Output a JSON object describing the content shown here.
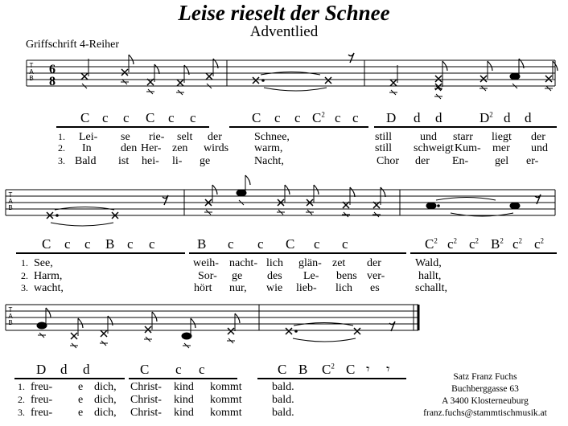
{
  "title": "Leise rieselt der Schnee",
  "subtitle": "Adventlied",
  "notation_label": "Griffschrift 4-Reiher",
  "time_signature": {
    "top": "6",
    "bottom": "8"
  },
  "tab_label": [
    "T",
    "A",
    "B"
  ],
  "system1": {
    "bass": [
      {
        "text": "C",
        "sup": ""
      },
      {
        "text": "c",
        "sup": ""
      },
      {
        "text": "c",
        "sup": ""
      },
      {
        "text": "C",
        "sup": ""
      },
      {
        "text": "c",
        "sup": ""
      },
      {
        "text": "c",
        "sup": ""
      },
      {
        "text": "C",
        "sup": ""
      },
      {
        "text": "c",
        "sup": ""
      },
      {
        "text": "c",
        "sup": ""
      },
      {
        "text": "C",
        "sup": "2"
      },
      {
        "text": "c",
        "sup": ""
      },
      {
        "text": "c",
        "sup": ""
      },
      {
        "text": "D",
        "sup": ""
      },
      {
        "text": "d",
        "sup": ""
      },
      {
        "text": "d",
        "sup": ""
      },
      {
        "text": "D",
        "sup": "2"
      },
      {
        "text": "d",
        "sup": ""
      },
      {
        "text": "d",
        "sup": ""
      }
    ],
    "verses": [
      {
        "num": "1.",
        "words": [
          "Lei-",
          "se",
          "rie-",
          "selt",
          "der",
          "Schnee,",
          "still",
          "und",
          "starr",
          "liegt",
          "der"
        ]
      },
      {
        "num": "2.",
        "words": [
          "In",
          "den",
          "Her-",
          "zen",
          "wirds",
          "warm,",
          "still",
          "schweigt",
          "Kum-",
          "mer",
          "und"
        ]
      },
      {
        "num": "3.",
        "words": [
          "Bald",
          "ist",
          "hei-",
          "li-",
          "ge",
          "Nacht,",
          "Chor",
          "der",
          "En-",
          "gel",
          "er-"
        ]
      }
    ]
  },
  "system2": {
    "bass": [
      {
        "text": "C",
        "sup": ""
      },
      {
        "text": "c",
        "sup": ""
      },
      {
        "text": "c",
        "sup": ""
      },
      {
        "text": "B",
        "sup": ""
      },
      {
        "text": "c",
        "sup": ""
      },
      {
        "text": "c",
        "sup": ""
      },
      {
        "text": "B",
        "sup": ""
      },
      {
        "text": "c",
        "sup": ""
      },
      {
        "text": "c",
        "sup": ""
      },
      {
        "text": "C",
        "sup": ""
      },
      {
        "text": "c",
        "sup": ""
      },
      {
        "text": "c",
        "sup": ""
      },
      {
        "text": "C",
        "sup": "2"
      },
      {
        "text": "c",
        "sup": "2"
      },
      {
        "text": "c",
        "sup": "2"
      },
      {
        "text": "B",
        "sup": "2"
      },
      {
        "text": "c",
        "sup": "2"
      },
      {
        "text": "c",
        "sup": "2"
      }
    ],
    "verses": [
      {
        "num": "1.",
        "words": [
          "See,",
          "weih-",
          "nacht-",
          "lich",
          "glän-",
          "zet",
          "der",
          "Wald,"
        ]
      },
      {
        "num": "2.",
        "words": [
          "Harm,",
          "Sor-",
          "ge",
          "des",
          "Le-",
          "bens",
          "ver-",
          "hallt,"
        ]
      },
      {
        "num": "3.",
        "words": [
          "wacht,",
          "hört",
          "nur,",
          "wie",
          "lieb-",
          "lich",
          "es",
          "schallt,"
        ]
      }
    ]
  },
  "system3": {
    "bass": [
      {
        "text": "D",
        "sup": ""
      },
      {
        "text": "d",
        "sup": ""
      },
      {
        "text": "d",
        "sup": ""
      },
      {
        "text": "C",
        "sup": ""
      },
      {
        "text": "c",
        "sup": ""
      },
      {
        "text": "c",
        "sup": ""
      },
      {
        "text": "C",
        "sup": ""
      },
      {
        "text": "B",
        "sup": ""
      },
      {
        "text": "C",
        "sup": "2"
      },
      {
        "text": "C",
        "sup": ""
      },
      {
        "text": "𝄾",
        "sup": ""
      },
      {
        "text": "𝄾",
        "sup": ""
      }
    ],
    "verses": [
      {
        "num": "1.",
        "words": [
          "freu-",
          "e",
          "dich,",
          "Christ-",
          "kind",
          "kommt",
          "bald."
        ]
      },
      {
        "num": "2.",
        "words": [
          "freu-",
          "e",
          "dich,",
          "Christ-",
          "kind",
          "kommt",
          "bald."
        ]
      },
      {
        "num": "3.",
        "words": [
          "freu-",
          "e",
          "dich,",
          "Christ-",
          "kind",
          "kommt",
          "bald."
        ]
      }
    ]
  },
  "credits": [
    "Satz Franz Fuchs",
    "Buchberggasse 63",
    "A 3400 Klosterneuburg",
    "franz.fuchs@stammtischmusik.at"
  ]
}
